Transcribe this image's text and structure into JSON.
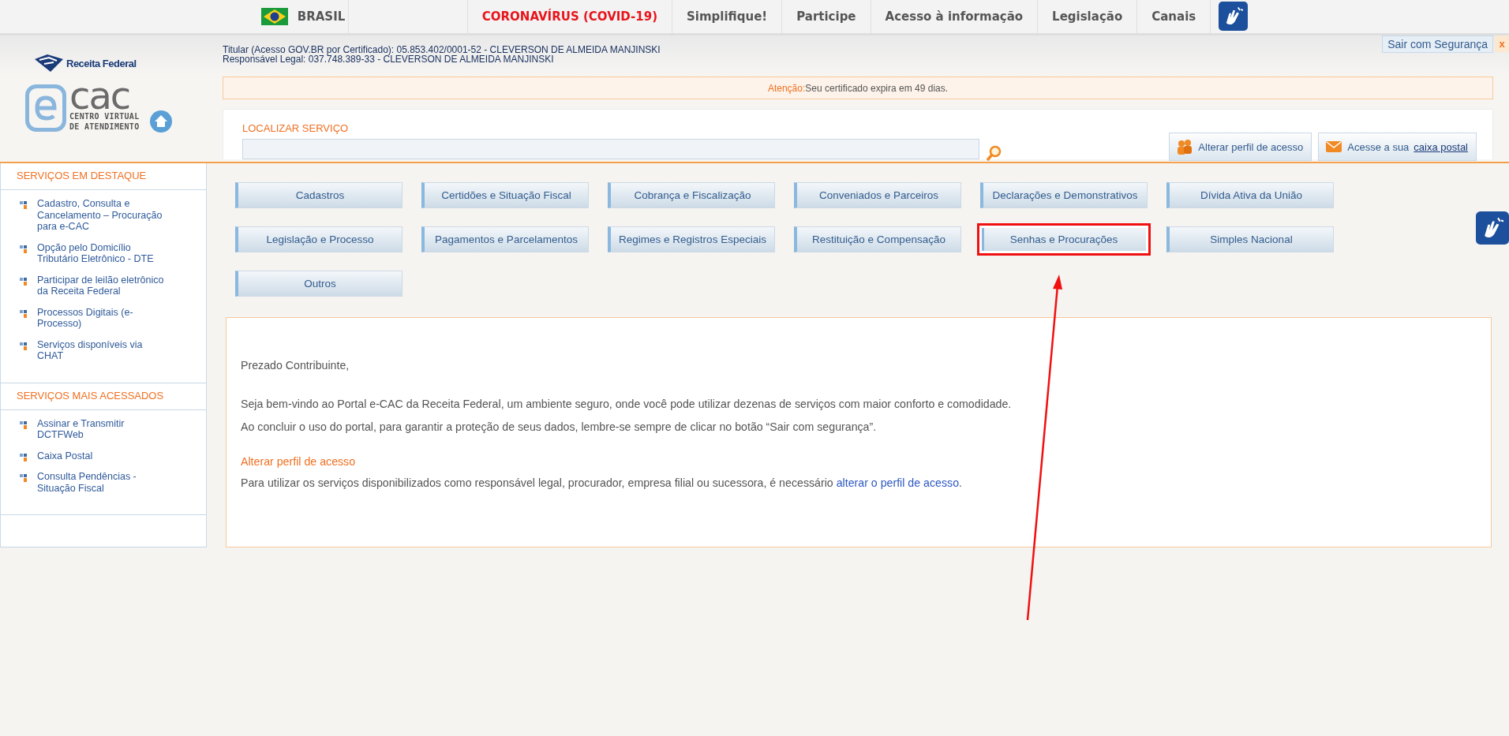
{
  "top_bar": {
    "country": "BRASIL",
    "items": [
      {
        "label": "CORONAVÍRUS (COVID-19)",
        "kind": "alert"
      },
      {
        "label": "Simplifique!",
        "kind": "plain"
      },
      {
        "label": "Participe",
        "kind": "plain"
      },
      {
        "label": "Acesso à informação",
        "kind": "plain"
      },
      {
        "label": "Legislação",
        "kind": "plain"
      },
      {
        "label": "Canais",
        "kind": "plain"
      }
    ]
  },
  "header": {
    "brand": "Receita Federal",
    "logo_main": "cac",
    "logo_sub": [
      "CENTRO VIRTUAL",
      "DE ATENDIMENTO"
    ],
    "user_lines": [
      "Titular (Acesso GOV.BR por Certificado): 05.853.402/0001-52 - CLEVERSON DE ALMEIDA MANJINSKI",
      "Responsável Legal: 037.748.389-33 - CLEVERSON DE ALMEIDA MANJINSKI"
    ],
    "logout": "Sair com Segurança",
    "close": "x",
    "notice": {
      "label": "Atenção:",
      "message": "Seu certificado expira em 49 dias."
    },
    "search": {
      "label": "LOCALIZAR SERVIÇO"
    },
    "profile_button": "Alterar perfil de acesso",
    "mailbox_button": {
      "text": "Acesse a sua ",
      "link": "caixa postal"
    }
  },
  "sidebar": {
    "sections": [
      {
        "title": "SERVIÇOS EM DESTAQUE",
        "items": [
          "Cadastro, Consulta e Cancelamento – Procuração para e-CAC",
          "Opção pelo Domicílio Tributário Eletrônico - DTE",
          "Participar de leilão eletrônico da Receita Federal",
          "Processos Digitais (e-Processo)",
          "Serviços disponíveis via CHAT"
        ]
      },
      {
        "title": "SERVIÇOS MAIS ACESSADOS",
        "items": [
          "Assinar e Transmitir DCTFWeb",
          "Caixa Postal",
          "Consulta Pendências - Situação Fiscal"
        ]
      }
    ]
  },
  "categories": [
    {
      "label": "Cadastros",
      "highlighted": false
    },
    {
      "label": "Certidões e Situação Fiscal",
      "highlighted": false
    },
    {
      "label": "Cobrança e Fiscalização",
      "highlighted": false
    },
    {
      "label": "Conveniados e Parceiros",
      "highlighted": false
    },
    {
      "label": "Declarações e Demonstrativos",
      "highlighted": false
    },
    {
      "label": "Dívida Ativa da União",
      "highlighted": false
    },
    {
      "label": "Legislação e Processo",
      "highlighted": false
    },
    {
      "label": "Pagamentos e Parcelamentos",
      "highlighted": false
    },
    {
      "label": "Regimes e Registros Especiais",
      "highlighted": false
    },
    {
      "label": "Restituição e Compensação",
      "highlighted": false
    },
    {
      "label": "Senhas e Procurações",
      "highlighted": true
    },
    {
      "label": "Simples Nacional",
      "highlighted": false
    },
    {
      "label": "Outros",
      "highlighted": false
    }
  ],
  "welcome": {
    "greeting": "Prezado Contribuinte,",
    "paragraphs": [
      "Seja bem-vindo ao Portal e-CAC da Receita Federal, um ambiente seguro, onde você pode utilizar dezenas de serviços com maior conforto e comodidade.",
      "Ao concluir o uso do portal, para garantir a proteção de seus dados, lembre-se sempre de clicar no botão “Sair com segurança”."
    ],
    "profile_heading": "Alterar perfil de acesso",
    "profile_text": "Para utilizar os serviços disponibilizados como responsável legal, procurador, empresa filial ou sucessora, é necessário ",
    "profile_link": "alterar o perfil de acesso",
    "profile_end": "."
  }
}
